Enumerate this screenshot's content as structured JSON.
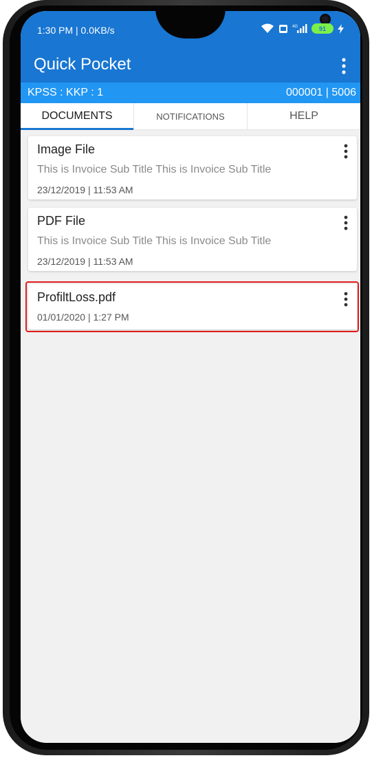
{
  "status_bar": {
    "time": "1:30 PM | 0.0KB/s",
    "battery_level": "91",
    "icons": [
      "wifi-icon",
      "volte-icon",
      "signal-icon",
      "battery-icon",
      "charging-icon"
    ]
  },
  "app_bar": {
    "title": "Quick Pocket",
    "menu_icon": "more-vert-icon"
  },
  "info_bar": {
    "left_text": "KPSS : KKP : 1",
    "right_text": "000001 | 5006"
  },
  "tabs": [
    {
      "label": "DOCUMENTS",
      "selected": true
    },
    {
      "label": "NOTIFICATIONS",
      "selected": false
    },
    {
      "label": "HELP",
      "selected": false
    }
  ],
  "documents": [
    {
      "title": "Image File",
      "subtitle": "This is Invoice Sub Title This is Invoice Sub Title",
      "date": "23/12/2019 | 11:53 AM"
    },
    {
      "title": "PDF File",
      "subtitle": "This is Invoice Sub Title This is Invoice Sub Title",
      "date": "23/12/2019 | 11:53 AM"
    },
    {
      "title": "ProfiltLoss.pdf",
      "subtitle": "",
      "date": "01/01/2020 | 1:27 PM",
      "highlighted": true
    }
  ],
  "colors": {
    "primary": "#1976d2",
    "info_bar": "#2196f3",
    "highlight_border": "#e21b1b",
    "battery": "#7cf04a"
  }
}
